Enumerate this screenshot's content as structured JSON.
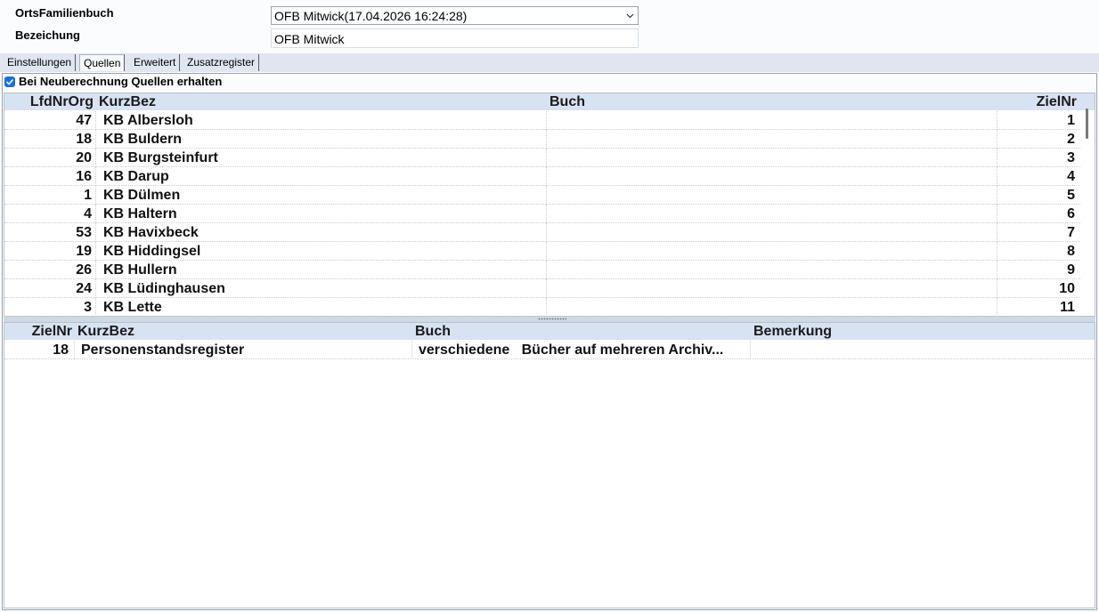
{
  "form": {
    "ofb_label": "OrtsFamilienbuch",
    "ofb_value": "OFB Mitwick(17.04.2026 16:24:28)",
    "bez_label": "Bezeichung",
    "bez_value": "OFB Mitwick"
  },
  "tabs": [
    "Einstellungen",
    "Quellen",
    "Erweitert",
    "Zusatzregister"
  ],
  "active_tab": "Quellen",
  "checkbox": {
    "label": "Bei Neuberechnung Quellen erhalten",
    "checked": true
  },
  "upper_grid": {
    "columns": [
      "LfdNrOrg",
      "KurzBez",
      "Buch",
      "ZielNr"
    ],
    "rows": [
      {
        "lfd": "47",
        "kurz": "KB Albersloh",
        "buch": "",
        "ziel": "1"
      },
      {
        "lfd": "18",
        "kurz": "KB Buldern",
        "buch": "",
        "ziel": "2"
      },
      {
        "lfd": "20",
        "kurz": "KB Burgsteinfurt",
        "buch": "",
        "ziel": "3"
      },
      {
        "lfd": "16",
        "kurz": "KB Darup",
        "buch": "",
        "ziel": "4"
      },
      {
        "lfd": "1",
        "kurz": "KB Dülmen",
        "buch": "",
        "ziel": "5"
      },
      {
        "lfd": "4",
        "kurz": "KB Haltern",
        "buch": "",
        "ziel": "6"
      },
      {
        "lfd": "53",
        "kurz": "KB Havixbeck",
        "buch": "",
        "ziel": "7"
      },
      {
        "lfd": "19",
        "kurz": "KB Hiddingsel",
        "buch": "",
        "ziel": "8"
      },
      {
        "lfd": "26",
        "kurz": "KB Hullern",
        "buch": "",
        "ziel": "9"
      },
      {
        "lfd": "24",
        "kurz": "KB Lüdinghausen",
        "buch": "",
        "ziel": "10"
      },
      {
        "lfd": "3",
        "kurz": "KB Lette",
        "buch": "",
        "ziel": "11"
      }
    ]
  },
  "lower_grid": {
    "columns": [
      "ZielNr",
      "KurzBez",
      "Buch",
      "Bemerkung"
    ],
    "rows": [
      {
        "ziel": "18",
        "kurz": "Personenstandsregister",
        "buch": "verschiedene   Bücher auf mehreren Archiv...",
        "bem": ""
      }
    ]
  }
}
